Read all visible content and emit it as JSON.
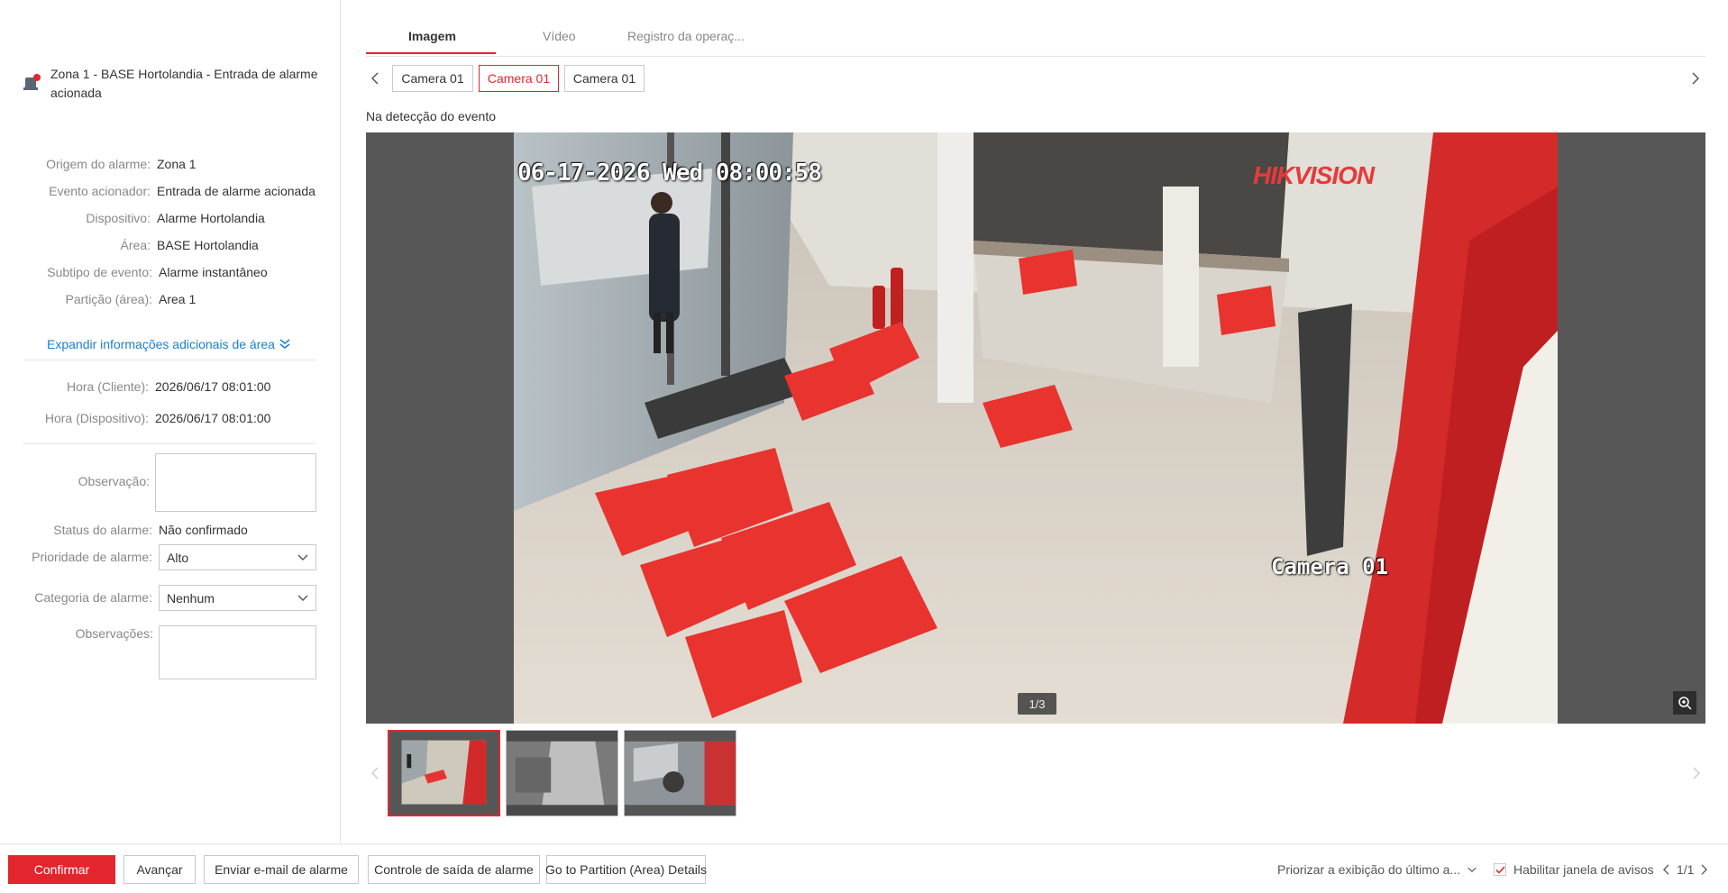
{
  "alarm": {
    "title": "Zona 1 - BASE Hortolandia - Entrada de alarme acionada"
  },
  "details": {
    "origin_label": "Origem do alarme:",
    "origin_value": "Zona 1",
    "event_label": "Evento acionador:",
    "event_value": "Entrada de alarme acionada",
    "device_label": "Dispositivo:",
    "device_value": "Alarme Hortolandia",
    "area_label": "Área:",
    "area_value": "BASE Hortolandia",
    "subtype_label": "Subtipo de evento:",
    "subtype_value": "Alarme instantâneo",
    "partition_label": "Partição (área):",
    "partition_value": "Area 1",
    "expand_link": "Expandir informações adicionais de área",
    "client_time_label": "Hora (Cliente):",
    "client_time_value": "2026/06/17 08:01:00",
    "device_time_label": "Hora (Dispositivo):",
    "device_time_value": "2026/06/17 08:01:00"
  },
  "form": {
    "observation_label": "Observação:",
    "status_label": "Status do alarme:",
    "status_value": "Não confirmado",
    "priority_label": "Prioridade de alarme:",
    "priority_value": "Alto",
    "category_label": "Categoria de alarme:",
    "category_value": "Nenhum",
    "remarks_label": "Observações:"
  },
  "tabs": [
    {
      "label": "Imagem",
      "active": true
    },
    {
      "label": "Vídeo",
      "active": false
    },
    {
      "label": "Registro da operaç..."
    }
  ],
  "cameras": [
    {
      "label": "Camera 01",
      "active": false
    },
    {
      "label": "Camera 01",
      "active": true
    },
    {
      "label": "Camera 01",
      "active": false
    }
  ],
  "viewer": {
    "caption": "Na detecção do evento",
    "osd_timestamp": "06-17-2026 Wed 08:00:58",
    "osd_camera": "Camera 01",
    "osd_brand": "HIKVISION",
    "pager": "1/3"
  },
  "footer": {
    "confirm": "Confirmar",
    "next": "Avançar",
    "send_email": "Enviar e-mail de alarme",
    "output_control": "Controle de saída de alarme",
    "partition_details": "Go to Partition (Area) Details",
    "prioritize": "Priorizar a exibição do último a...",
    "enable_popup": "Habilitar janela de avisos",
    "page": "1/1"
  },
  "colors": {
    "accent": "#e3262e",
    "link": "#1a7fd4"
  }
}
